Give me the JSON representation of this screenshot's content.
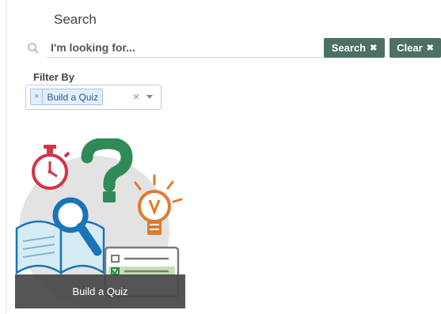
{
  "search": {
    "title": "Search",
    "icon": "search-icon",
    "placeholder": "I'm looking for...",
    "search_button_label": "Search",
    "clear_button_label": "Clear",
    "button_x_glyph": "✖",
    "button_color": "#4c7163"
  },
  "filter": {
    "label": "Filter By",
    "selected": [
      {
        "label": "Build a Quiz",
        "remove_glyph": "×"
      }
    ],
    "clear_glyph": "×"
  },
  "card": {
    "caption": "Build a Quiz",
    "icons": [
      "stopwatch-icon",
      "question-mark-icon",
      "lightbulb-icon",
      "magnifier-icon",
      "book-icon",
      "quiz-checklist-icon"
    ]
  },
  "colors": {
    "accent": "#4c7163",
    "chip_bg": "#e4eefa",
    "stopwatch": "#d1344a",
    "question_mark": "#2e8b57",
    "lightbulb": "#e07a2e",
    "magnifier": "#1a74b8"
  }
}
